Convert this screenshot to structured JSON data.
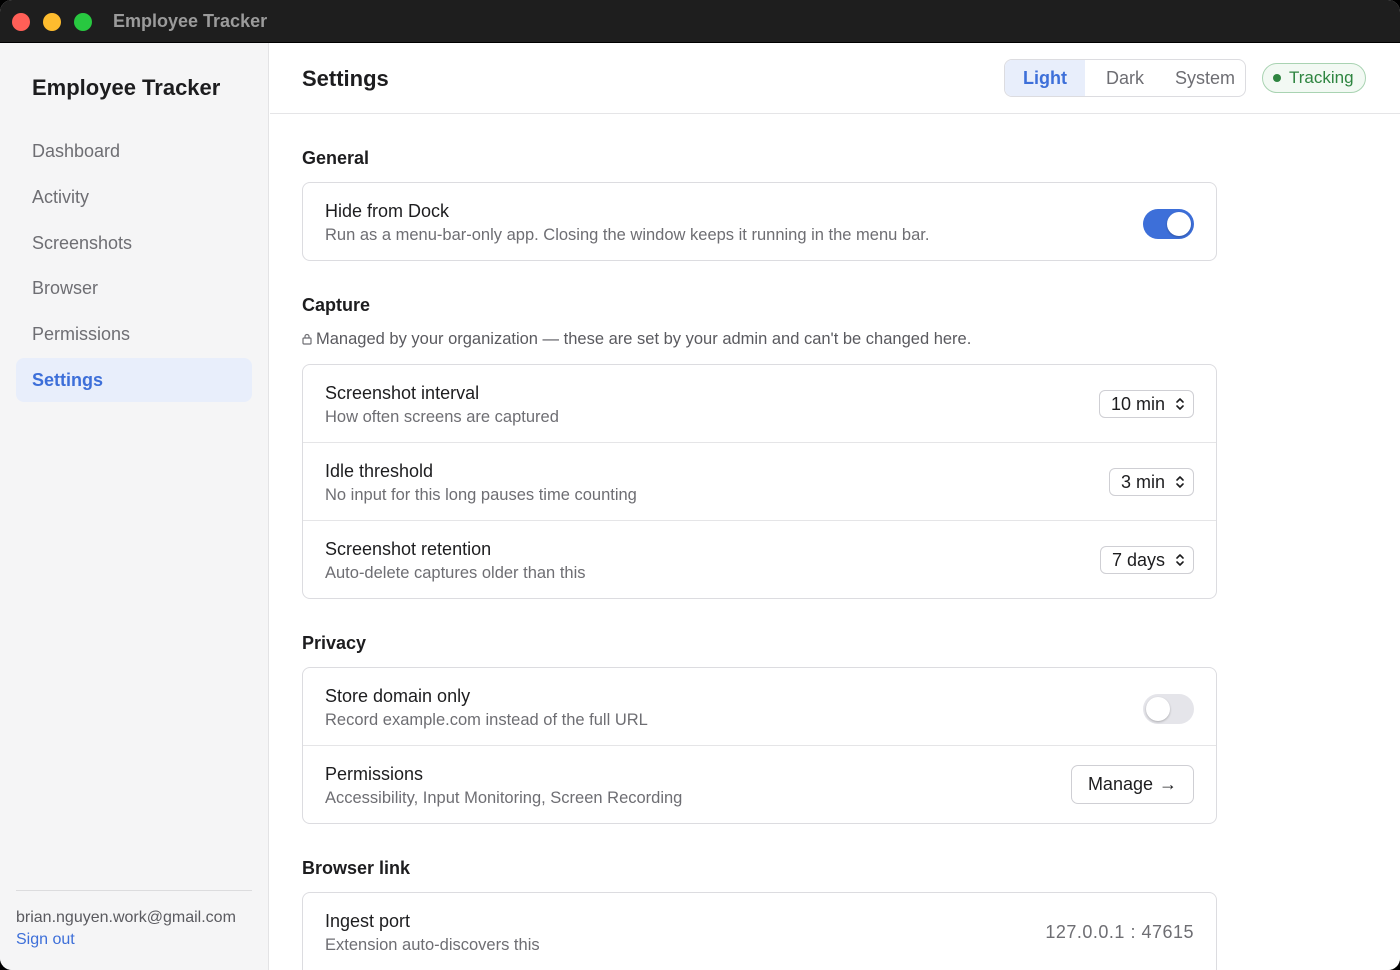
{
  "window": {
    "title": "Employee Tracker"
  },
  "sidebar": {
    "brand": "Employee Tracker",
    "items": [
      {
        "label": "Dashboard"
      },
      {
        "label": "Activity"
      },
      {
        "label": "Screenshots"
      },
      {
        "label": "Browser"
      },
      {
        "label": "Permissions"
      },
      {
        "label": "Settings",
        "active": true
      }
    ],
    "user_email": "brian.nguyen.work@gmail.com",
    "sign_out_label": "Sign out"
  },
  "header": {
    "title": "Settings",
    "theme_options": [
      "Light",
      "Dark",
      "System"
    ],
    "theme_selected": "Light",
    "status_label": "Tracking",
    "status_color": "#2e8540"
  },
  "sections": {
    "general": {
      "title": "General",
      "hide_from_dock": {
        "title": "Hide from Dock",
        "subtitle": "Run as a menu-bar-only app. Closing the window keeps it running in the menu bar.",
        "enabled": true
      }
    },
    "capture": {
      "title": "Capture",
      "managed_note": "Managed by your organization — these are set by your admin and can't be changed here.",
      "managed_icon": "lock-icon",
      "screenshot_interval": {
        "title": "Screenshot interval",
        "subtitle": "How often screens are captured",
        "value": "10 min"
      },
      "idle_threshold": {
        "title": "Idle threshold",
        "subtitle": "No input for this long pauses time counting",
        "value": "3 min"
      },
      "screenshot_retention": {
        "title": "Screenshot retention",
        "subtitle": "Auto-delete captures older than this",
        "value": "7 days"
      }
    },
    "privacy": {
      "title": "Privacy",
      "store_domain_only": {
        "title": "Store domain only",
        "subtitle": "Record example.com instead of the full URL",
        "enabled": false
      },
      "permissions": {
        "title": "Permissions",
        "subtitle": "Accessibility, Input Monitoring, Screen Recording",
        "button_label": "Manage",
        "button_icon": "arrow-right-icon"
      }
    },
    "browser_link": {
      "title": "Browser link",
      "ingest_port": {
        "title": "Ingest port",
        "subtitle": "Extension auto-discovers this",
        "value": "127.0.0.1 : 47615"
      }
    }
  },
  "colors": {
    "accent": "#3d6fd9",
    "accent_bg": "#e8eefb"
  }
}
